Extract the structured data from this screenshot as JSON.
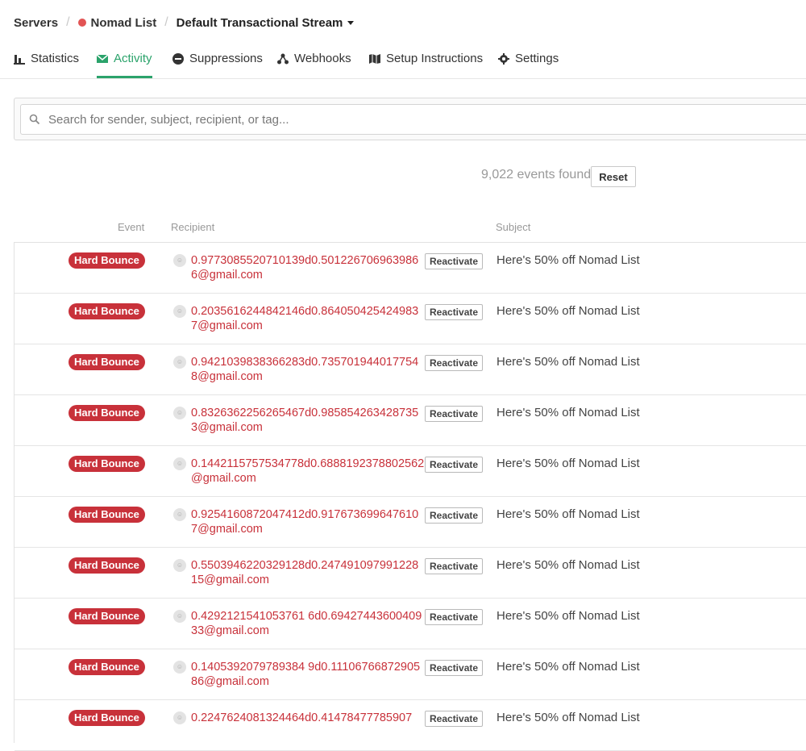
{
  "breadcrumb": {
    "servers": "Servers",
    "server_name": "Nomad List",
    "server_color": "#e25454",
    "stream": "Default Transactional Stream"
  },
  "tabs": [
    {
      "label": "Statistics",
      "icon": "bar-chart-icon",
      "active": false
    },
    {
      "label": "Activity",
      "icon": "envelope-icon",
      "active": true
    },
    {
      "label": "Suppressions",
      "icon": "minus-circle-icon",
      "active": false
    },
    {
      "label": "Webhooks",
      "icon": "webhook-icon",
      "active": false
    },
    {
      "label": "Setup Instructions",
      "icon": "map-icon",
      "active": false
    },
    {
      "label": "Settings",
      "icon": "gear-icon",
      "active": false
    }
  ],
  "search": {
    "placeholder": "Search for sender, subject, recipient, or tag..."
  },
  "results": {
    "count_text": "9,022 events found",
    "reset_label": "Reset"
  },
  "table": {
    "headers": {
      "event": "Event",
      "recipient": "Recipient",
      "subject": "Subject"
    },
    "rows": [
      {
        "event": "Hard Bounce",
        "recipient": "0.9773085520710139d0.5012267069639866@gmail.com",
        "action": "Reactivate",
        "subject": "Here's 50% off Nomad List"
      },
      {
        "event": "Hard Bounce",
        "recipient": "0.2035616244842146d0.8640504254249837@gmail.com",
        "action": "Reactivate",
        "subject": "Here's 50% off Nomad List"
      },
      {
        "event": "Hard Bounce",
        "recipient": "0.9421039838366283d0.7357019440177548@gmail.com",
        "action": "Reactivate",
        "subject": "Here's 50% off Nomad List"
      },
      {
        "event": "Hard Bounce",
        "recipient": "0.8326362256265467d0.9858542634287353@gmail.com",
        "action": "Reactivate",
        "subject": "Here's 50% off Nomad List"
      },
      {
        "event": "Hard Bounce",
        "recipient": "0.1442115757534778d0.6888192378802562@gmail.com",
        "action": "Reactivate",
        "subject": "Here's 50% off Nomad List"
      },
      {
        "event": "Hard Bounce",
        "recipient": "0.9254160872047412d0.9176736996476107@gmail.com",
        "action": "Reactivate",
        "subject": "Here's 50% off Nomad List"
      },
      {
        "event": "Hard Bounce",
        "recipient": "0.5503946220329128d0.24749109799122815@gmail.com",
        "action": "Reactivate",
        "subject": "Here's 50% off Nomad List"
      },
      {
        "event": "Hard Bounce",
        "recipient": "0.4292121541053761 6d0.6942744360040933@gmail.com",
        "action": "Reactivate",
        "subject": "Here's 50% off Nomad List"
      },
      {
        "event": "Hard Bounce",
        "recipient": "0.1405392079789384 9d0.1110676687290586@gmail.com",
        "action": "Reactivate",
        "subject": "Here's 50% off Nomad List"
      },
      {
        "event": "Hard Bounce",
        "recipient": "0.2247624081324464d0.41478477785907",
        "action": "Reactivate",
        "subject": "Here's 50% off Nomad List"
      }
    ]
  },
  "colors": {
    "accent": "#2ba36b",
    "bounce": "#c8313a"
  }
}
